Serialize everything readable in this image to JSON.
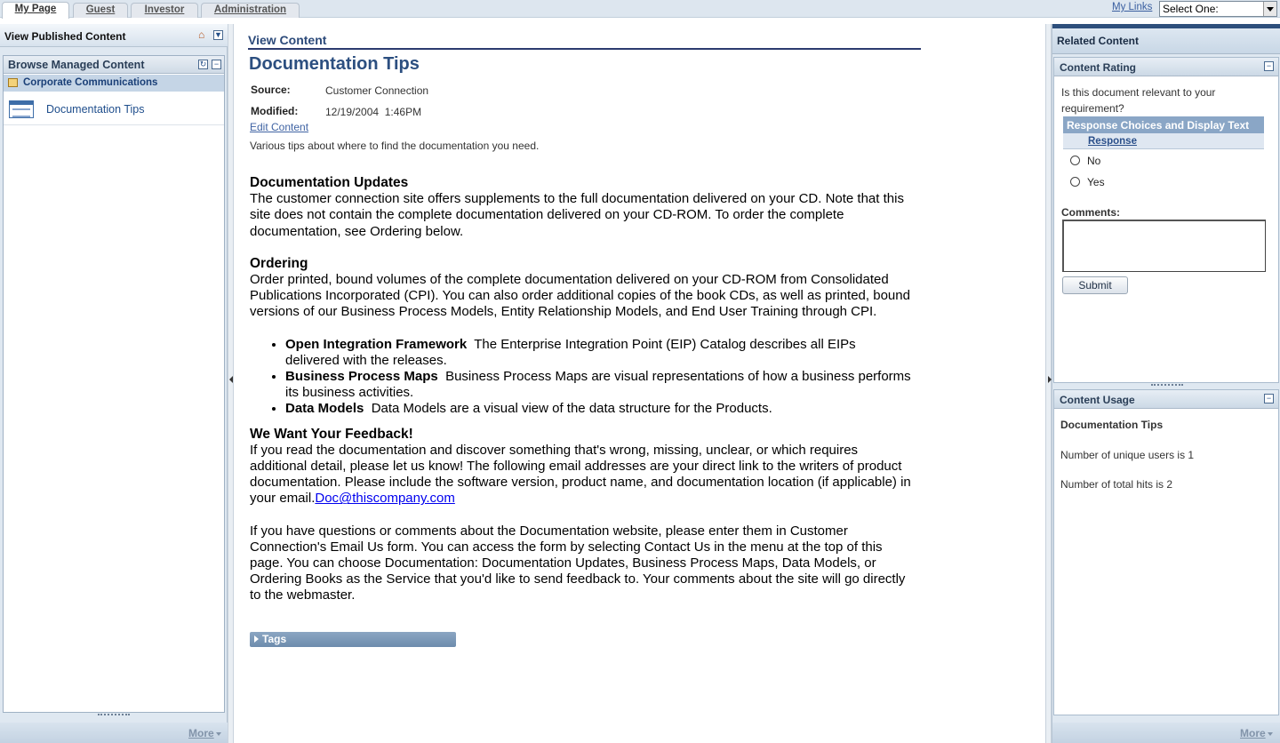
{
  "tabs": [
    {
      "label": "My Page",
      "active": true
    },
    {
      "label": "Guest",
      "active": false
    },
    {
      "label": "Investor",
      "active": false
    },
    {
      "label": "Administration",
      "active": false
    }
  ],
  "top_right": {
    "my_links": "My Links",
    "select_value": "Select One:"
  },
  "left": {
    "header_title": "View Published Content",
    "browse_title": "Browse Managed Content",
    "folder_label": "Corporate Communications",
    "item_label": "Documentation Tips",
    "more": "More"
  },
  "content": {
    "section_title": "View Content",
    "doc_title": "Documentation Tips",
    "source_label": "Source:",
    "source_value": "Customer Connection",
    "modified_label": "Modified:",
    "modified_value": "12/19/2004  1:46PM",
    "edit_link": "Edit Content",
    "summary": "Various tips about where to find the documentation you need.",
    "updates_heading": "Documentation Updates",
    "updates_text": "The customer connection site offers supplements to the full documentation delivered on your CD. Note that this site does not contain the complete documentation delivered on your CD-ROM. To order the complete documentation, see Ordering  below.",
    "ordering_heading": "Ordering",
    "ordering_text": "Order printed, bound volumes of the complete documentation delivered on your CD-ROM from Consolidated Publications Incorporated (CPI). You can also order additional copies of the book CDs, as well as printed, bound versions of our Business Process Models, Entity Relationship Models, and End User Training through CPI.",
    "bullets": [
      {
        "term": "Open Integration Framework",
        "text": "  The Enterprise Integration Point (EIP) Catalog describes all EIPs delivered with the releases."
      },
      {
        "term": "Business Process Maps",
        "text": "  Business Process Maps are visual representations of how a business performs its business activities."
      },
      {
        "term": "Data Models",
        "text": "  Data Models are a visual view of the data structure for the Products."
      }
    ],
    "feedback_heading": "We Want Your Feedback!",
    "feedback_text": "If you read the documentation and discover something that's wrong, missing, unclear, or which requires additional detail, please let us know! The following email addresses are your direct link to the writers of product documentation. Please include the software version, product name, and documentation location (if applicable) in your email.",
    "feedback_email": "Doc@thiscompany.com",
    "questions_text": "If you have questions or comments about the Documentation website, please enter them in Customer Connection's Email Us form. You can access the form by selecting Contact Us in the menu at the top of this page. You can choose Documentation: Documentation Updates, Business Process Maps, Data Models, or Ordering Books as the Service that you'd like to send feedback to. Your comments about the site will go directly to the webmaster.",
    "tags_label": "Tags"
  },
  "right": {
    "header_title": "Related Content",
    "rating": {
      "title": "Content Rating",
      "question": "Is this document relevant to your requirement?",
      "table_header": "Response Choices and Display Text",
      "table_sub": "Response",
      "options": [
        "No",
        "Yes"
      ],
      "comments_label": "Comments:",
      "submit": "Submit"
    },
    "usage": {
      "title": "Content Usage",
      "doc": "Documentation Tips",
      "unique_users": "Number of unique users is 1",
      "total_hits": "Number of total hits is 2"
    },
    "more": "More"
  }
}
